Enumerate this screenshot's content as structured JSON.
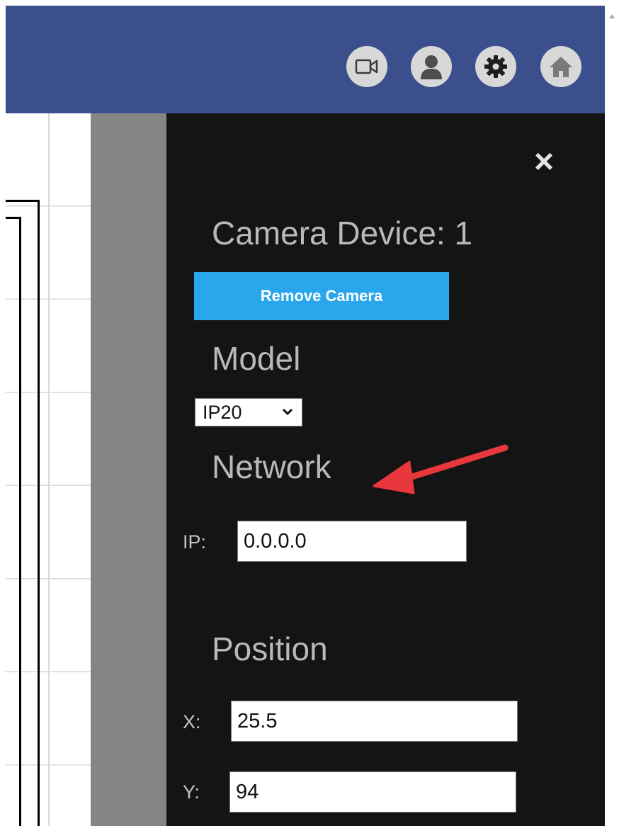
{
  "header": {
    "icons": [
      "camera-icon",
      "user-icon",
      "gear-icon",
      "home-icon"
    ],
    "background_color": "#3a4f8b"
  },
  "panel": {
    "title": "Camera Device: 1",
    "remove_button_label": "Remove Camera",
    "model_heading": "Model",
    "model_value": "IP20",
    "network_heading": "Network",
    "ip_label": "IP:",
    "ip_value": "0.0.0.0",
    "position_heading": "Position",
    "x_label": "X:",
    "x_value": "25.5",
    "y_label": "Y:",
    "y_value": "94",
    "close_label": "×"
  },
  "colors": {
    "panel_bg": "#141414",
    "accent_button": "#2aa7ec",
    "annotation_arrow": "#e8383d"
  }
}
